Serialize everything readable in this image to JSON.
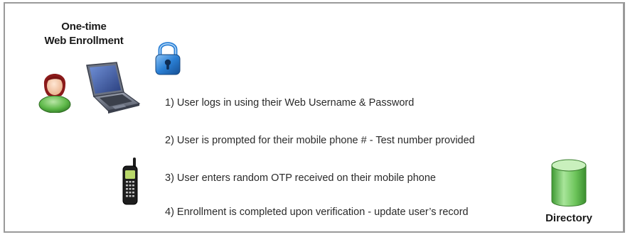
{
  "title": {
    "line1": "One-time",
    "line2": "Web Enrollment"
  },
  "steps": [
    "1) User logs in using their Web Username & Password",
    "2) User is prompted for their mobile phone # - Test number provided",
    "3) User enters random OTP received on their mobile phone",
    "4) Enrollment is completed upon verification - update user’s record"
  ],
  "directory": {
    "label": "Directory"
  },
  "icons": {
    "user": "user-icon",
    "laptop": "laptop-icon",
    "lock": "lock-icon",
    "phone": "mobile-phone-icon",
    "database": "database-icon"
  },
  "colors": {
    "lock_blue": "#2a7fd4",
    "user_green": "#5fb94a",
    "user_hair": "#8b1a1a",
    "laptop_blue": "#3d5a9e",
    "db_green": "#6cc45a",
    "border": "#9a9a9a"
  }
}
